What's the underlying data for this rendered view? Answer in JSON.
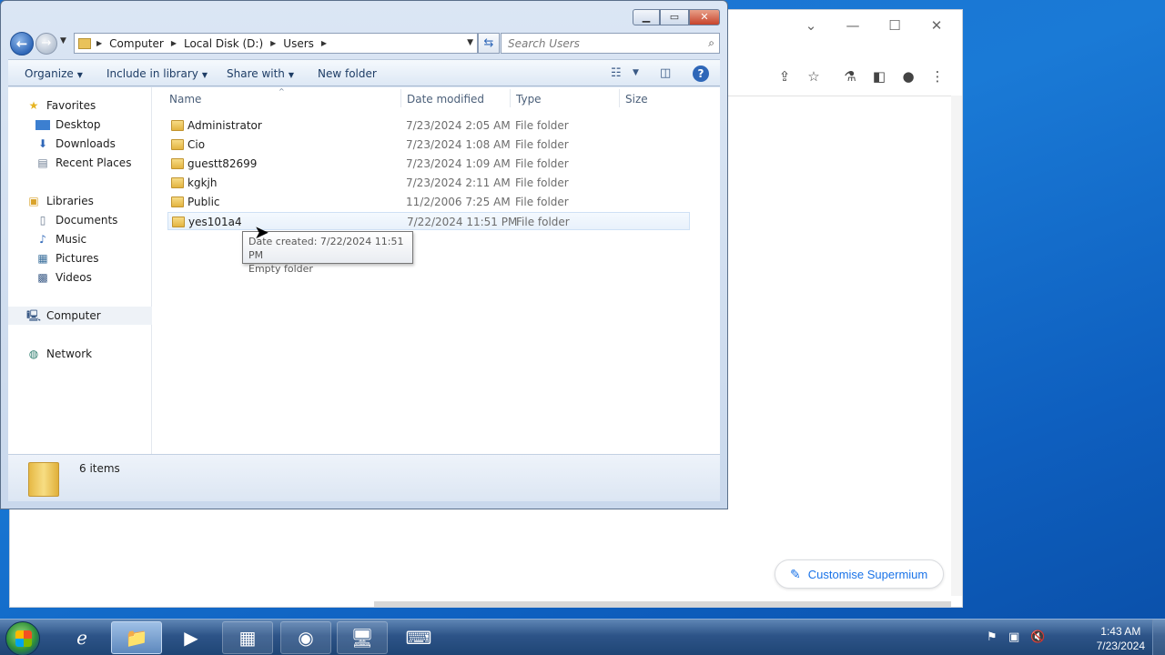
{
  "browser": {
    "customise_label": "Customise Supermium"
  },
  "explorer": {
    "breadcrumb": [
      "Computer",
      "Local Disk (D:)",
      "Users"
    ],
    "search_placeholder": "Search Users",
    "commands": {
      "organize": "Organize",
      "include_in_library": "Include in library",
      "share_with": "Share with",
      "new_folder": "New folder"
    },
    "nav": {
      "favorites": "Favorites",
      "desktop": "Desktop",
      "downloads": "Downloads",
      "recent_places": "Recent Places",
      "libraries": "Libraries",
      "documents": "Documents",
      "music": "Music",
      "pictures": "Pictures",
      "videos": "Videos",
      "computer": "Computer",
      "network": "Network"
    },
    "columns": {
      "name": "Name",
      "date_modified": "Date modified",
      "type": "Type",
      "size": "Size"
    },
    "files": [
      {
        "name": "Administrator",
        "date": "7/23/2024 2:05 AM",
        "type": "File folder"
      },
      {
        "name": "Cio",
        "date": "7/23/2024 1:08 AM",
        "type": "File folder"
      },
      {
        "name": "guestt82699",
        "date": "7/23/2024 1:09 AM",
        "type": "File folder"
      },
      {
        "name": "kgkjh",
        "date": "7/23/2024 2:11 AM",
        "type": "File folder"
      },
      {
        "name": "Public",
        "date": "11/2/2006 7:25 AM",
        "type": "File folder"
      },
      {
        "name": "yes101a4",
        "date": "7/22/2024 11:51 PM",
        "type": "File folder"
      }
    ],
    "tooltip": {
      "line1": "Date created: 7/22/2024 11:51 PM",
      "line2": "Empty folder"
    },
    "item_count": "6 items"
  },
  "taskbar": {
    "time": "1:43 AM",
    "date": "7/23/2024"
  },
  "colors": {
    "desktop": "#1a7ad6",
    "accent_link": "#1a73e8"
  }
}
